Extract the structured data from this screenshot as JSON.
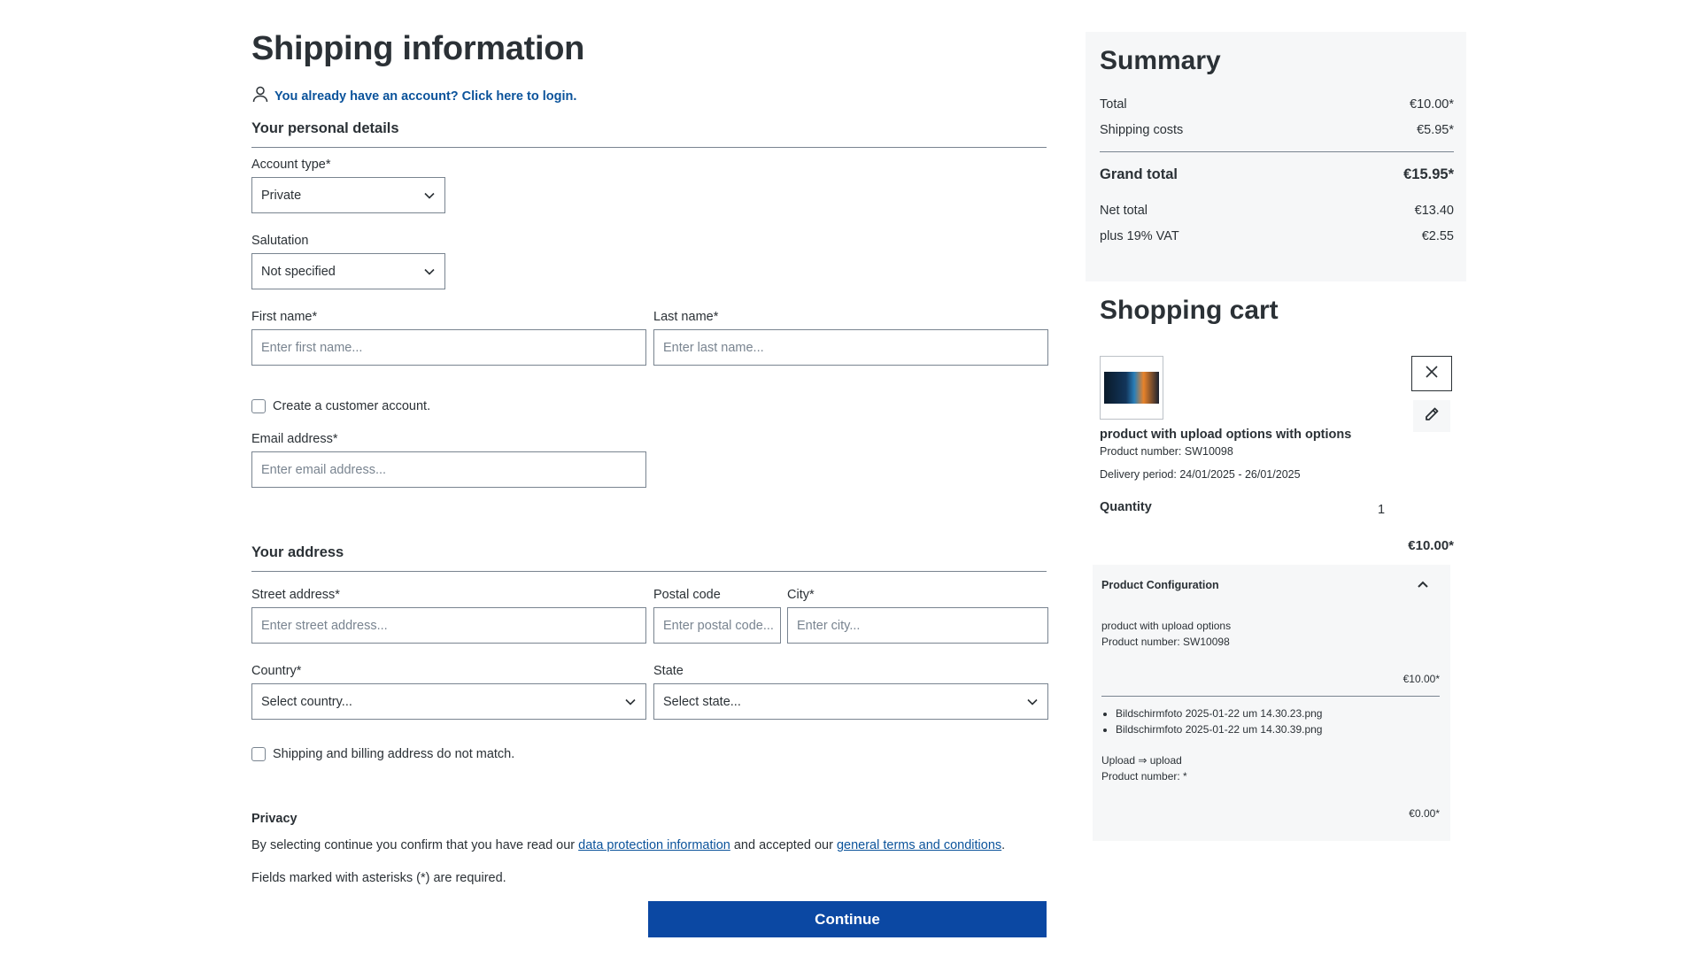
{
  "page": {
    "title": "Shipping information",
    "login_prompt": "You already have an account? Click here to login."
  },
  "personal": {
    "heading": "Your personal details",
    "account_type_label": "Account type*",
    "account_type_value": "Private",
    "salutation_label": "Salutation",
    "salutation_value": "Not specified",
    "first_name_label": "First name*",
    "first_name_placeholder": "Enter first name...",
    "last_name_label": "Last name*",
    "last_name_placeholder": "Enter last name...",
    "create_account_label": "Create a customer account.",
    "email_label": "Email address*",
    "email_placeholder": "Enter email address..."
  },
  "address": {
    "heading": "Your address",
    "street_label": "Street address*",
    "street_placeholder": "Enter street address...",
    "postal_label": "Postal code",
    "postal_placeholder": "Enter postal code...",
    "city_label": "City*",
    "city_placeholder": "Enter city...",
    "country_label": "Country*",
    "country_value": "Select country...",
    "state_label": "State",
    "state_value": "Select state...",
    "billing_mismatch_label": "Shipping and billing address do not match."
  },
  "privacy": {
    "heading": "Privacy",
    "text_before": "By selecting continue you confirm that you have read our ",
    "link_data_protection": "data protection information",
    "text_middle": " and accepted our ",
    "link_terms": "general terms and conditions",
    "text_after": ".",
    "required_note": "Fields marked with asterisks (*) are required."
  },
  "actions": {
    "continue_label": "Continue"
  },
  "summary": {
    "title": "Summary",
    "total_label": "Total",
    "total_value": "€10.00*",
    "shipping_label": "Shipping costs",
    "shipping_value": "€5.95*",
    "grand_label": "Grand total",
    "grand_value": "€15.95*",
    "net_label": "Net total",
    "net_value": "€13.40",
    "vat_label": "plus 19% VAT",
    "vat_value": "€2.55"
  },
  "cart": {
    "title": "Shopping cart",
    "item": {
      "name": "product with upload options with options",
      "number": "Product number: SW10098",
      "delivery": "Delivery period: 24/01/2025 - 26/01/2025",
      "quantity_label": "Quantity",
      "quantity_value": "1",
      "price": "€10.00*"
    },
    "config": {
      "title": "Product Configuration",
      "product_name": "product with upload options",
      "product_number": "Product number: SW10098",
      "product_price": "€10.00*",
      "files": [
        "Bildschirmfoto 2025-01-22 um 14.30.23.png",
        "Bildschirmfoto 2025-01-22 um 14.30.39.png"
      ],
      "upload_label": "Upload ⇒ upload",
      "upload_number": "Product number: *",
      "upload_price": "€0.00*"
    }
  },
  "icons": {
    "user": "user-icon",
    "chevron_down": "chevron-down-icon",
    "chevron_up": "chevron-up-icon",
    "close": "close-icon",
    "pencil": "pencil-icon"
  },
  "colors": {
    "primary": "#0b48a3",
    "link": "#0b539b",
    "text": "#2b3136",
    "border": "#798490",
    "panel": "#f6f7f8"
  }
}
